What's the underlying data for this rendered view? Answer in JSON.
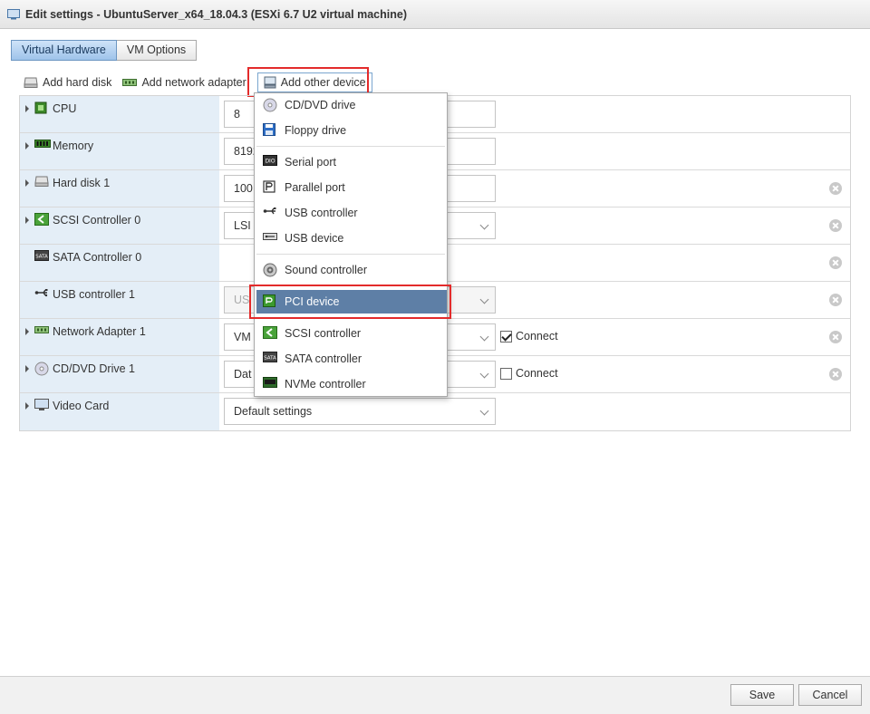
{
  "window": {
    "title": "Edit settings - UbuntuServer_x64_18.04.3 (ESXi 6.7 U2 virtual machine)"
  },
  "tabs": [
    {
      "label": "Virtual Hardware",
      "active": true
    },
    {
      "label": "VM Options",
      "active": false
    }
  ],
  "toolbar": {
    "add_hard_disk": "Add hard disk",
    "add_network_adapter": "Add network adapter",
    "add_other_device": "Add other device"
  },
  "hardware": {
    "cpu": {
      "label": "CPU",
      "value": "8"
    },
    "memory": {
      "label": "Memory",
      "value": "8192"
    },
    "hard_disk": {
      "label": "Hard disk 1",
      "value": "100"
    },
    "scsi": {
      "label": "SCSI Controller 0",
      "value": "LSI"
    },
    "sata": {
      "label": "SATA Controller 0"
    },
    "usb": {
      "label": "USB controller 1",
      "value": "US"
    },
    "network": {
      "label": "Network Adapter 1",
      "value": "VM",
      "connect_label": "Connect",
      "connected": true
    },
    "cdrom": {
      "label": "CD/DVD Drive 1",
      "value": "Dat",
      "connect_label": "Connect",
      "connected": false
    },
    "video": {
      "label": "Video Card",
      "value": "Default settings"
    }
  },
  "menu": {
    "items": [
      "CD/DVD drive",
      "Floppy drive",
      "Serial port",
      "Parallel port",
      "USB controller",
      "USB device",
      "Sound controller",
      "PCI device",
      "SCSI controller",
      "SATA controller",
      "NVMe controller"
    ],
    "highlighted": "PCI device"
  },
  "footer": {
    "save": "Save",
    "cancel": "Cancel"
  },
  "colors": {
    "highlight": "#5e7fa6",
    "annotation": "#e32b2b",
    "label_bg": "#e4eef7"
  }
}
